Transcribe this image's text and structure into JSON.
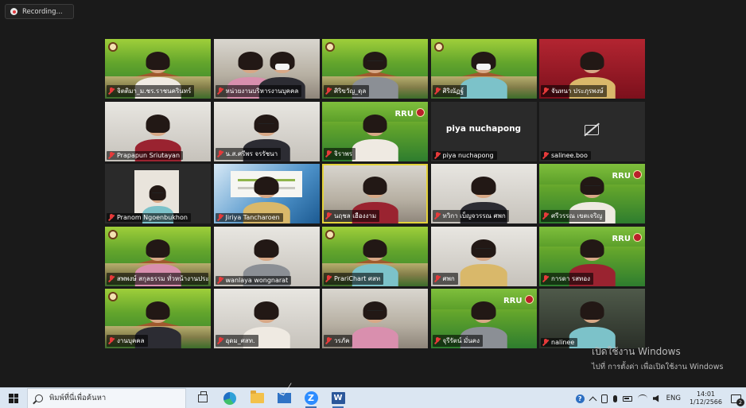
{
  "recording": {
    "label": "Recording..."
  },
  "participants": [
    {
      "name": "จิตติมา_ม.ชร.ราชนครินทร์",
      "bg": "green"
    },
    {
      "name": "หน่วยงานบริหารงานบุคคล",
      "bg": "room"
    },
    {
      "name": "ศิริขวัญ_ดุล",
      "bg": "green"
    },
    {
      "name": "ศิริณัฏฐ์",
      "bg": "green"
    },
    {
      "name": "จันทนา ประภุรพงษ์",
      "bg": "red"
    },
    {
      "name": "Prapapun Sriutayan",
      "bg": "office"
    },
    {
      "name": "น.ส.ศรีพร จรรัชนา",
      "bg": "office"
    },
    {
      "name": "จิราพร",
      "bg": "green_rru"
    },
    {
      "name": "piya nuchapong",
      "bg": "dark",
      "center_name": "piya nuchapong"
    },
    {
      "name": "salinee.boo",
      "bg": "dark",
      "video_off": true
    },
    {
      "name": "Pranom Ngoenbukhon",
      "bg": "dark_photo"
    },
    {
      "name": "Jiriya Tancharoen",
      "bg": "blue"
    },
    {
      "name": "นฤชล เฮืองงาม",
      "bg": "room",
      "speaking": true
    },
    {
      "name": "ทวิกา เบ็ญจวรรณ ศพก",
      "bg": "office"
    },
    {
      "name": "ศรีวรรณ เขตเจริญ",
      "bg": "green_rru"
    },
    {
      "name": "สพพงษ์ สกุลธรรม ทั่วหน้างานประ...",
      "bg": "green"
    },
    {
      "name": "wanlaya wongnarat",
      "bg": "office"
    },
    {
      "name": "PrariChart ศสท",
      "bg": "green"
    },
    {
      "name": "ศพก",
      "bg": "office"
    },
    {
      "name": "การดา รสทอง",
      "bg": "green_rru"
    },
    {
      "name": "งานบุคคล",
      "bg": "green"
    },
    {
      "name": "อุดม_ศสท.",
      "bg": "office"
    },
    {
      "name": "วรภัค",
      "bg": "room"
    },
    {
      "name": "จุรีรัตน์ มั่นคง",
      "bg": "green_rru"
    },
    {
      "name": "nalinee",
      "bg": "window"
    }
  ],
  "rru_label": "RRU",
  "activation": {
    "line1": "เปิดใช้งาน Windows",
    "line2": "ไปที่ การตั้งค่า เพื่อเปิดใช้งาน Windows"
  },
  "taskbar": {
    "search_placeholder": "พิมพ์ที่นี่เพื่อค้นหา",
    "zoom_label": "Z",
    "word_label": "W",
    "help_label": "?",
    "language": "ENG",
    "time": "14:01",
    "date": "1/12/2566",
    "notification_count": "2"
  }
}
